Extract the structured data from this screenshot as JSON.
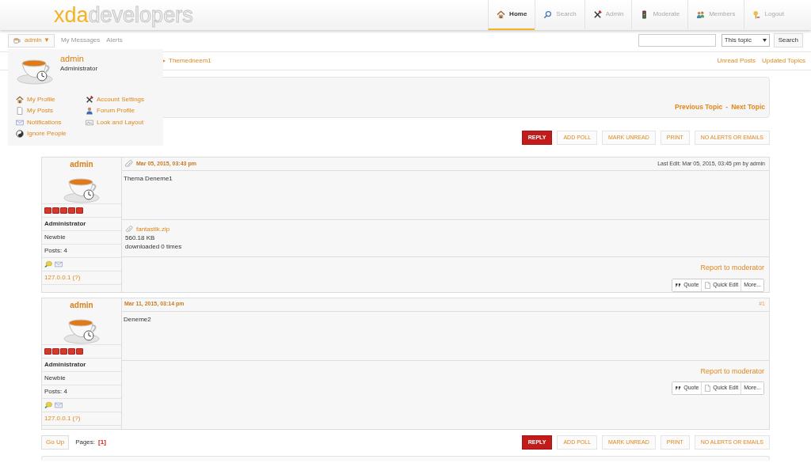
{
  "logo": {
    "brand": "xda",
    "suffix": "developers"
  },
  "nav_tabs": [
    {
      "label": "Home",
      "selected": true
    },
    {
      "label": "Search",
      "selected": false
    },
    {
      "label": "Admin",
      "selected": false
    },
    {
      "label": "Moderate",
      "selected": false
    },
    {
      "label": "Members",
      "selected": false
    },
    {
      "label": "Logout",
      "selected": false
    }
  ],
  "user_bar": {
    "user_button": "admin",
    "caret": "▼",
    "links": [
      "My Messages",
      "Alerts"
    ],
    "search_scope": "This topic",
    "search_button": "Search"
  },
  "breadcrumb": {
    "separator": "▸",
    "current": "Themedneem1",
    "links": [
      "Unread Posts",
      "Updated Topics"
    ]
  },
  "user_dropdown": {
    "name": "admin",
    "group": "Administrator",
    "columns": [
      [
        "My Profile",
        "My Posts",
        "Notifications",
        "Ignore People"
      ],
      [
        "Account Settings",
        "Forum Profile",
        "Look and Layout"
      ]
    ]
  },
  "topic_nav": {
    "previous": "Previous Topic",
    "separator": "-",
    "next": "Next Topic"
  },
  "action_buttons": [
    {
      "label": "REPLY",
      "primary": true
    },
    {
      "label": "ADD POLL",
      "primary": false
    },
    {
      "label": "MARK UNREAD",
      "primary": false
    },
    {
      "label": "PRINT",
      "primary": false
    },
    {
      "label": "NO ALERTS OR EMAILS",
      "primary": false
    }
  ],
  "posts": [
    {
      "poster": {
        "name": "admin",
        "stars": 5,
        "group": "Administrator",
        "rank": "Newbie",
        "posts": "Posts: 4",
        "ip": "127.0.0.1 (?)"
      },
      "date": "Mar 05, 2015, 03:43 pm",
      "last_edit": "Last Edit: Mar 05, 2015, 03:45 pm by admin",
      "body": "Thema Deneme1",
      "attachments": [
        {
          "file": "fantastik.zip",
          "size": "560.18 KB",
          "downloads": "downloaded 0 times"
        }
      ],
      "report": "Report to moderator",
      "buttons": [
        "Quote",
        "Quick Edit",
        "More..."
      ]
    },
    {
      "poster": {
        "name": "admin",
        "stars": 5,
        "group": "Administrator",
        "rank": "Newbie",
        "posts": "Posts: 4",
        "ip": "127.0.0.1 (?)"
      },
      "date": "Mar 11, 2015, 03:14 pm",
      "number": "#1",
      "body": "Deneme2",
      "report": "Report to moderator",
      "buttons": [
        "Quote",
        "Quick Edit",
        "More..."
      ]
    }
  ],
  "pagination": {
    "go_up": "Go Up",
    "label": "Pages:",
    "current": "[1]"
  },
  "bottom_buttons": [
    {
      "label": "REPLY",
      "primary": true
    },
    {
      "label": "ADD POLL",
      "primary": false
    },
    {
      "label": "MARK UNREAD",
      "primary": false
    },
    {
      "label": "PRINT",
      "primary": false
    },
    {
      "label": "NO ALERTS OR EMAILS",
      "primary": false
    }
  ]
}
